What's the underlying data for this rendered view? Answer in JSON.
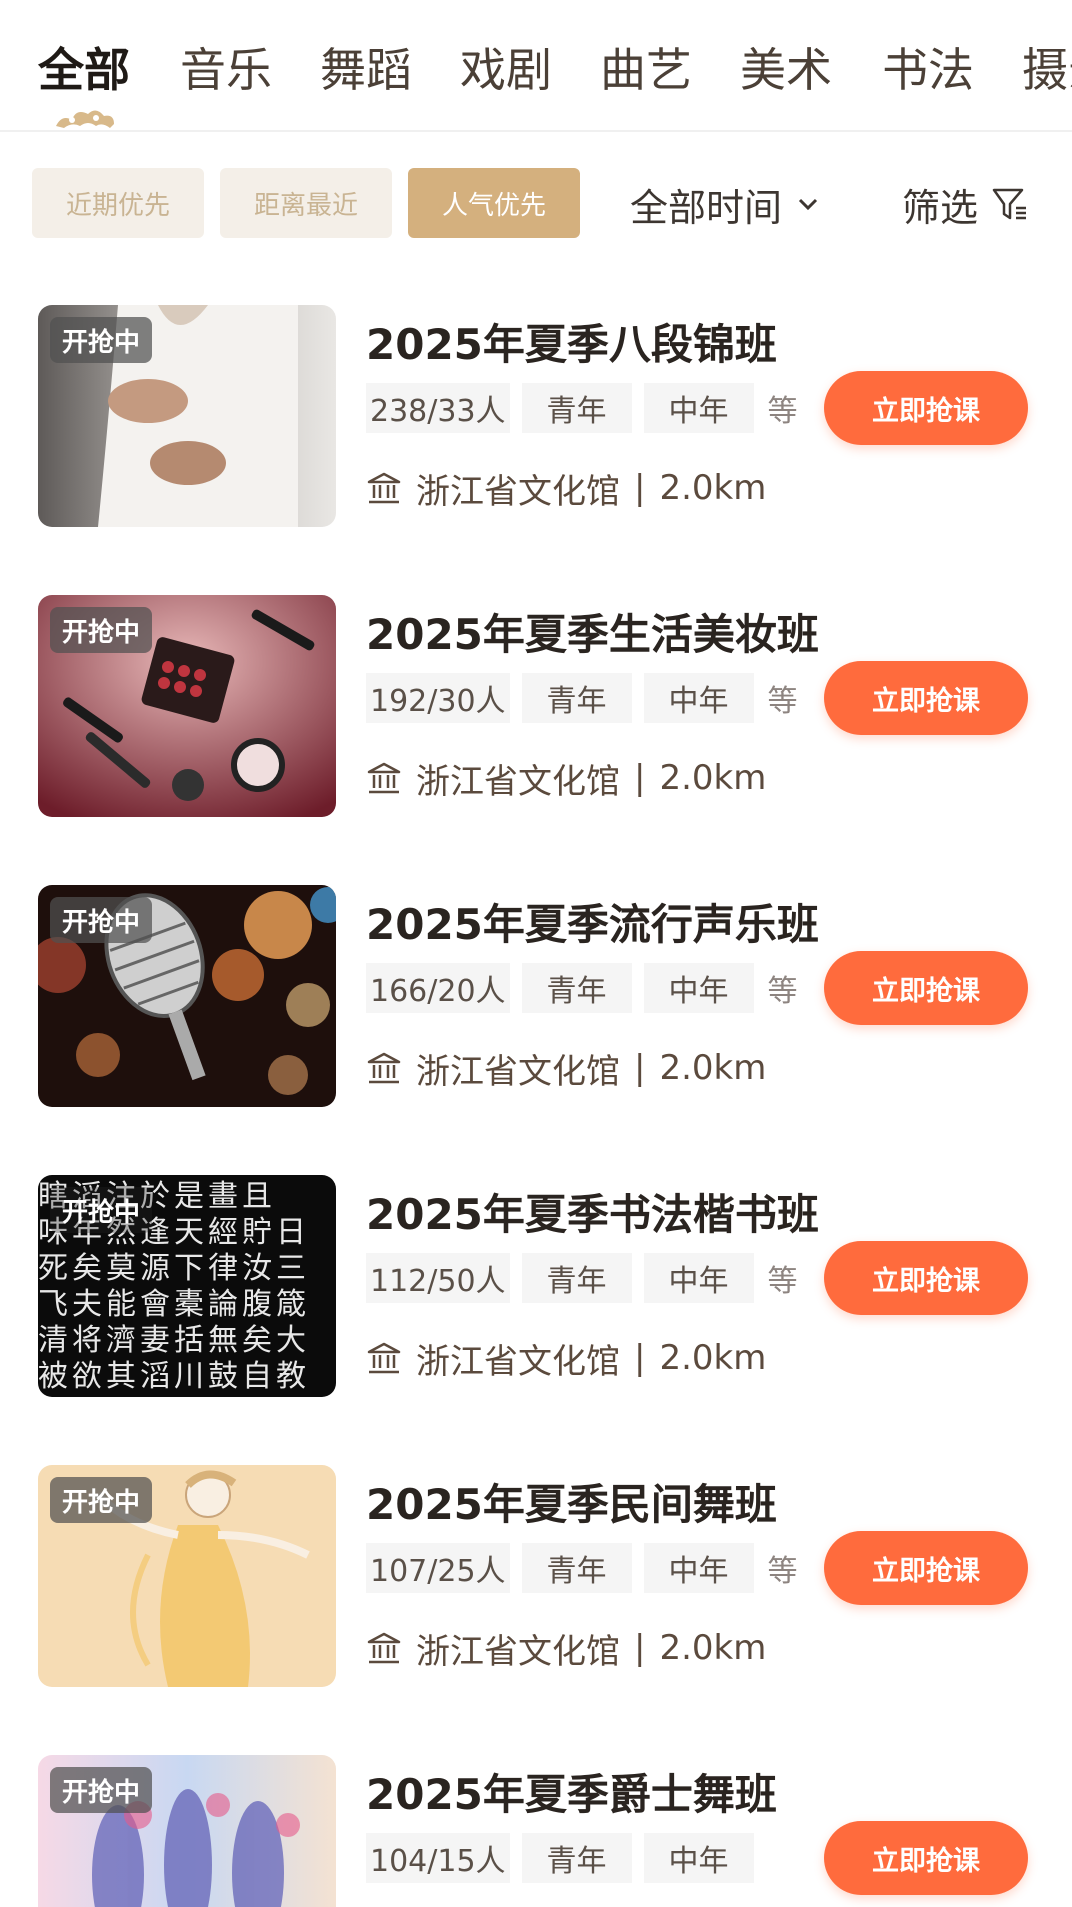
{
  "tabs": [
    "全部",
    "音乐",
    "舞蹈",
    "戏剧",
    "曲艺",
    "美术",
    "书法",
    "摄影"
  ],
  "sort_options": [
    {
      "label": "近期优先",
      "active": false
    },
    {
      "label": "距离最近",
      "active": false
    },
    {
      "label": "人气优先",
      "active": true
    }
  ],
  "time_filter": {
    "label": "全部时间"
  },
  "filter": {
    "label": "筛选"
  },
  "colors": {
    "accent": "#d4b07e",
    "button": "#ff6b3d",
    "text": "#2a2420"
  },
  "courses": [
    {
      "title": "2025年夏季八段锦班",
      "status": "开抢中",
      "enrolled": "238/33人",
      "ages": [
        "青年",
        "中年"
      ],
      "etc": "等",
      "venue": "浙江省文化馆",
      "distance": "2.0km",
      "action": "立即抢课",
      "image": "tai-chi-photo"
    },
    {
      "title": "2025年夏季生活美妆班",
      "status": "开抢中",
      "enrolled": "192/30人",
      "ages": [
        "青年",
        "中年"
      ],
      "etc": "等",
      "venue": "浙江省文化馆",
      "distance": "2.0km",
      "action": "立即抢课",
      "image": "makeup-photo"
    },
    {
      "title": "2025年夏季流行声乐班",
      "status": "开抢中",
      "enrolled": "166/20人",
      "ages": [
        "青年",
        "中年"
      ],
      "etc": "等",
      "venue": "浙江省文化馆",
      "distance": "2.0km",
      "action": "立即抢课",
      "image": "microphone-photo"
    },
    {
      "title": "2025年夏季书法楷书班",
      "status": "开抢中",
      "enrolled": "112/50人",
      "ages": [
        "青年",
        "中年"
      ],
      "etc": "等",
      "venue": "浙江省文化馆",
      "distance": "2.0km",
      "action": "立即抢课",
      "image": "calligraphy-photo"
    },
    {
      "title": "2025年夏季民间舞班",
      "status": "开抢中",
      "enrolled": "107/25人",
      "ages": [
        "青年",
        "中年"
      ],
      "etc": "等",
      "venue": "浙江省文化馆",
      "distance": "2.0km",
      "action": "立即抢课",
      "image": "folk-dance-illustration"
    },
    {
      "title": "2025年夏季爵士舞班",
      "status": "开抢中",
      "enrolled": "104/15人",
      "ages": [
        "青年",
        "中年"
      ],
      "etc": "",
      "venue": "",
      "distance": "",
      "action": "立即抢课",
      "image": "jazz-dance-illustration"
    }
  ],
  "calligraphy_texture": [
    "瞎滔注於是畫且",
    "味年然逢天經貯日",
    "死矣莫源下律汝三",
    "飞夫能會橐論腹箴",
    "清将濟妻括無矣大",
    "被欲其滔川鼓自教"
  ],
  "separator": "|"
}
